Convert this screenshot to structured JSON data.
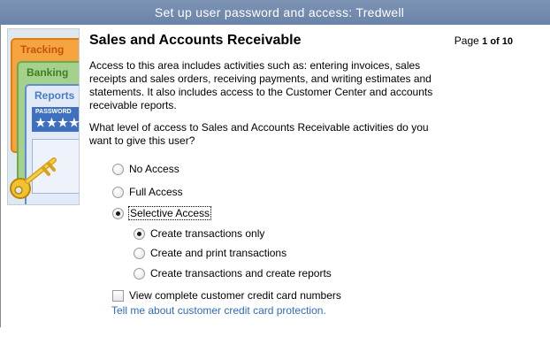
{
  "window": {
    "title": "Set up user password and access: Tredwell"
  },
  "illustration": {
    "tracking_label": "Tracking",
    "banking_label": "Banking",
    "reports_label": "Reports",
    "password_label": "PASSWORD",
    "password_mask": "★★★★"
  },
  "header": {
    "title": "Sales and Accounts Receivable",
    "page_prefix": "Page ",
    "page_value": "1 of 10"
  },
  "body": {
    "description": "Access to this area includes activities such as: entering invoices, sales receipts and sales orders, receiving payments, and writing estimates and statements. It also includes access to the Customer Center and accounts receivable reports.",
    "question": "What level of access to Sales and Accounts Receivable activities do you want to give this user?"
  },
  "access_options": [
    {
      "label": "No Access",
      "selected": false
    },
    {
      "label": "Full Access",
      "selected": false
    },
    {
      "label": "Selective Access",
      "selected": true
    }
  ],
  "selective_options": [
    {
      "label": "Create transactions only",
      "selected": true
    },
    {
      "label": "Create and print transactions",
      "selected": false
    },
    {
      "label": "Create transactions and create reports",
      "selected": false
    }
  ],
  "credit_card": {
    "checkbox_label": "View complete customer credit card numbers",
    "checked": false,
    "link_text": "Tell me about customer credit card protection."
  },
  "colors": {
    "title_bar": "#6a83a8",
    "link": "#2e6bbf"
  }
}
